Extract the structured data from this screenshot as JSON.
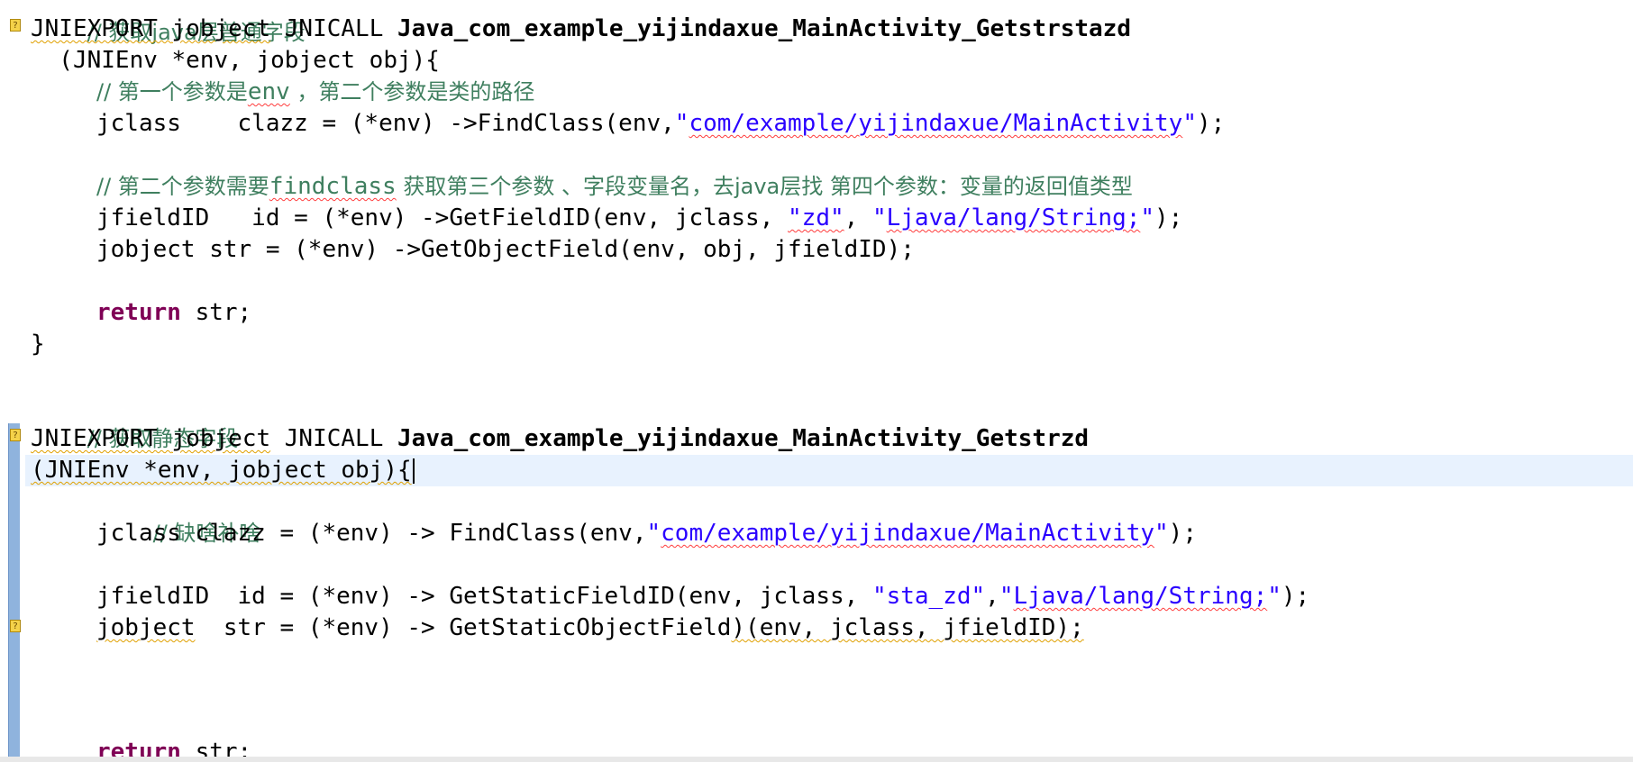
{
  "editor": {
    "lines": {
      "l0_comment": "// 获取java层普通字段",
      "l1_prefix": "JNIEXPORT ",
      "l1_jobject": "jobject",
      "l1_jnicall": " JNICALL ",
      "l1_fn": "Java_com_example_yijindaxue_MainActivity_Getstrstazd",
      "l2": "  (JNIEnv *env, jobject obj){",
      "l3_comment_a": "// 第一个参数是",
      "l3_comment_b": "env",
      "l3_comment_c": " ，第二个参数是类的路径",
      "l4_code": "jclass    clazz = (*env) ->FindClass(env,",
      "l4_str_a": "\"",
      "l4_str_b": "com/example/yijindaxue/MainActivity",
      "l4_str_c": "\"",
      "l4_end": ");",
      "l6_comment_a": "// 第二个参数需要",
      "l6_comment_b": "findclass",
      "l6_comment_c": " 获取第三个参数 、字段变量名，去java层找 第四个参数：变量的返回值类型",
      "l7_code": "jfieldID   id = (*env) ->GetFieldID(env, jclass, ",
      "l7_str1": "\"zd\"",
      "l7_mid": ", ",
      "l7_str2_a": "\"",
      "l7_str2_b": "Ljava/lang/String;",
      "l7_str2_c": "\"",
      "l7_end": ");",
      "l8": "jobject str = (*env) ->GetObjectField(env, obj, jfieldID);",
      "l10_kw": "return",
      "l10_rest": " str;",
      "l11": "}",
      "l13_comment": "// 获取静态字段",
      "l14_prefix": "JNIEXPORT ",
      "l14_jobject": "jobject",
      "l14_jnicall": " JNICALL ",
      "l14_fn": "Java_com_example_yijindaxue_MainActivity_Getstrzd",
      "l15": "(JNIEnv *env, jobject obj){",
      "l16_comment": "// 缺啥补啥",
      "l17_code": "jclass clazz = (*env) -> FindClass(env,",
      "l17_str_a": "\"",
      "l17_str_b": "com/example/yijindaxue/MainActivity",
      "l17_str_c": "\"",
      "l17_end": ");",
      "l19_code": "jfieldID  id = (*env) -> GetStaticFieldID(env, jclass, ",
      "l19_str1": "\"sta_zd\"",
      "l19_mid": ",",
      "l19_str2_a": "\"",
      "l19_str2_b": "Ljava/lang/String;",
      "l19_str2_c": "\"",
      "l19_end": ");",
      "l20_a": "jobject",
      "l20_b": "  str = (*env) -> GetStaticObjectField",
      "l20_c": ")(env, jclass, jfieldID);",
      "l24_kw": "return",
      "l24_rest": " str;"
    },
    "markers": [
      "?",
      "?",
      "?"
    ],
    "colors": {
      "comment": "#3f7f5f",
      "keyword": "#7f0055",
      "string": "#2a00ff",
      "current_line": "#e8f2fe",
      "change_bar": "#8fb3dd"
    }
  }
}
